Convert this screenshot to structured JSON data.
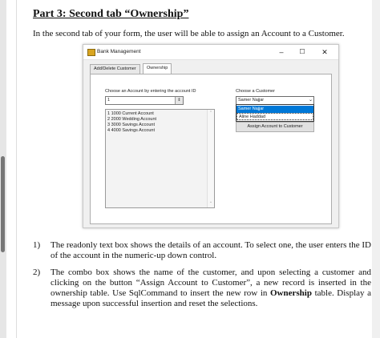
{
  "doc": {
    "heading": "Part 3: Second tab “Ownership”",
    "intro": "In the second tab of your form, the user will be able to assign an Account to a Customer."
  },
  "window": {
    "title": "Bank Management",
    "minimize_glyph": "–",
    "maximize_glyph": "☐",
    "close_glyph": "✕",
    "tabs": [
      {
        "label": "Add/Delete Customer"
      },
      {
        "label": "Ownership"
      }
    ],
    "account_label": "Choose an Account by entering the account ID",
    "numeric_value": "1",
    "details": [
      "1 1000 Current Account",
      "2 2000 Wedding Account",
      "3 3000 Savings Account",
      "4 4000 Savings Account"
    ],
    "customer_label": "Choose a Customer",
    "combo_value": "Samer Najjar",
    "combo_options": [
      "Samer Najjar",
      "Aline Haddad"
    ],
    "assign_button": "Assign Account to Customer"
  },
  "items": [
    {
      "num": "1)",
      "text": "The readonly text box shows the details of an account. To select one, the user enters the ID of the account in the numeric-up down control."
    },
    {
      "num": "2)",
      "text_a": "The combo box shows the name of the customer, and upon selecting a customer and clicking on the button “Assign Account to Customer”, a new record is inserted in the ownership table. Use SqlCommand to insert the new row in ",
      "bold": "Ownership",
      "text_b": " table. Display a message upon successful insertion and reset the selections."
    }
  ]
}
